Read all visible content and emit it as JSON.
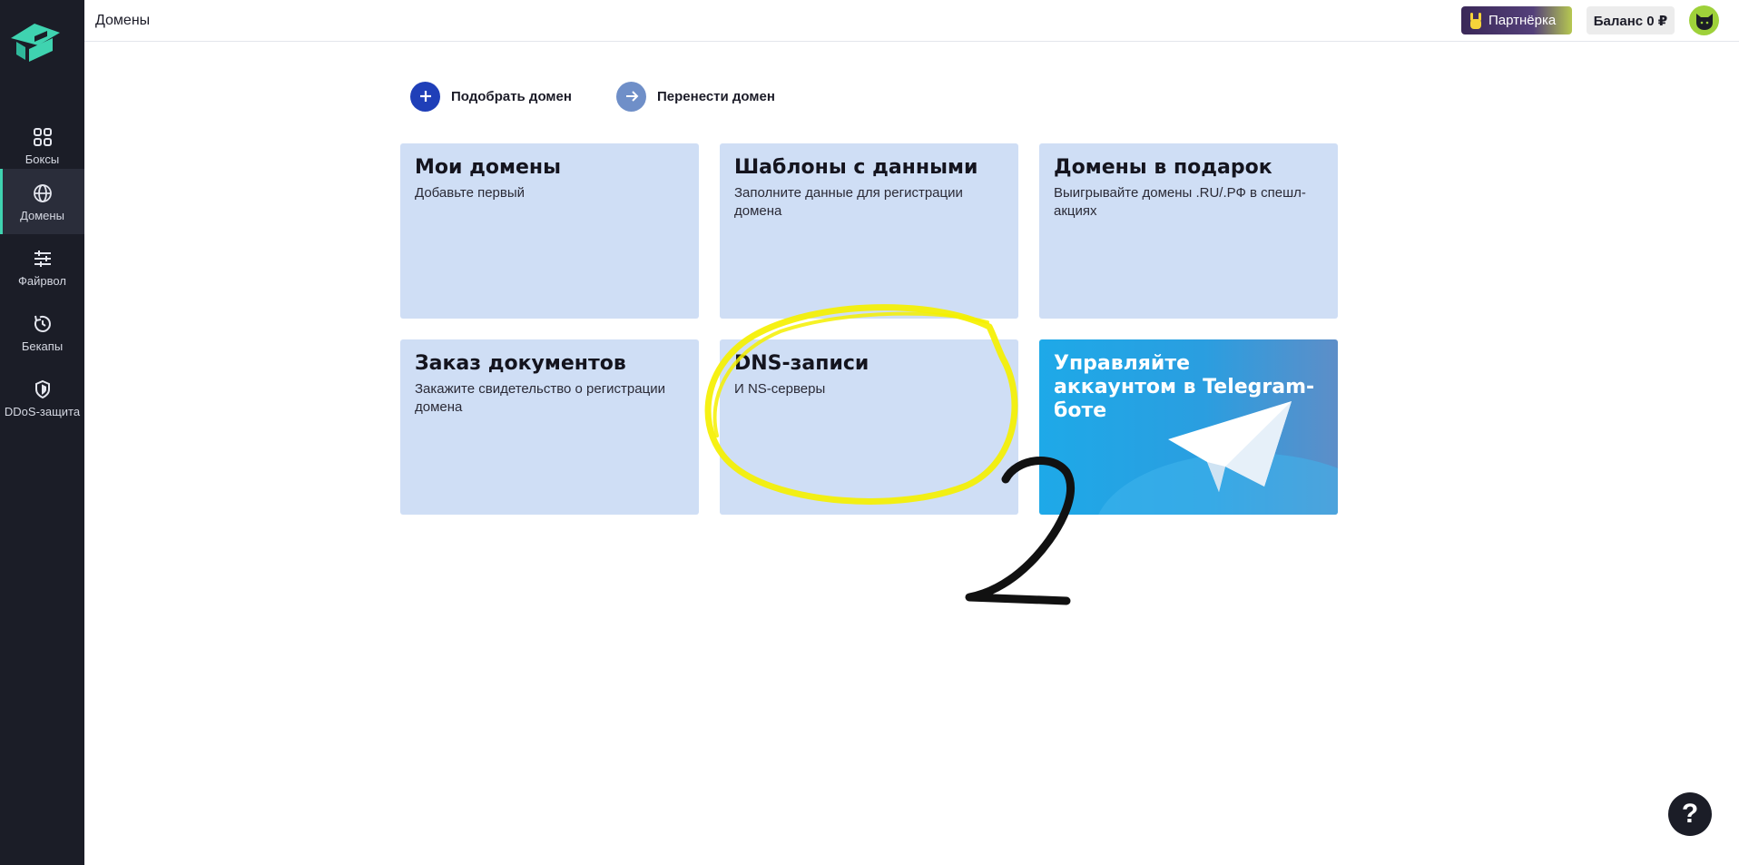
{
  "header": {
    "title": "Домены",
    "partner_label": "Партнёрка",
    "balance_label": "Баланс 0 ₽"
  },
  "sidebar": {
    "items": [
      {
        "label": "Боксы",
        "icon": "grid-icon"
      },
      {
        "label": "Домены",
        "icon": "globe-icon",
        "active": true
      },
      {
        "label": "Файрвол",
        "icon": "sliders-icon"
      },
      {
        "label": "Бекапы",
        "icon": "backup-icon"
      },
      {
        "label": "DDoS-защита",
        "icon": "shield-icon"
      }
    ]
  },
  "actions": {
    "pick_domain": "Подобрать домен",
    "transfer_domain": "Перенести домен"
  },
  "cards": [
    {
      "title": "Мои домены",
      "desc": "Добавьте первый"
    },
    {
      "title": "Шаблоны с данными",
      "desc": "Заполните данные для регистрации домена"
    },
    {
      "title": "Домены в подарок",
      "desc": "Выигрывайте домены .RU/.РФ в спешл-акциях"
    },
    {
      "title": "Заказ документов",
      "desc": "Закажите свидетельство о регистрации домена"
    },
    {
      "title": "DNS-записи",
      "desc": "И NS-серверы"
    },
    {
      "title": "Управляйте аккаунтом в Telegram-боте",
      "desc": ""
    }
  ],
  "annotation": {
    "step_number": "2",
    "highlight_color": "#f5f000"
  },
  "help": {
    "label": "?"
  },
  "colors": {
    "sidebar_bg": "#1b1d27",
    "card_bg": "#cfdef5",
    "accent_teal": "#3fd3b0",
    "pick_circle": "#1f3fb8",
    "transfer_circle": "#6f8fc8"
  }
}
